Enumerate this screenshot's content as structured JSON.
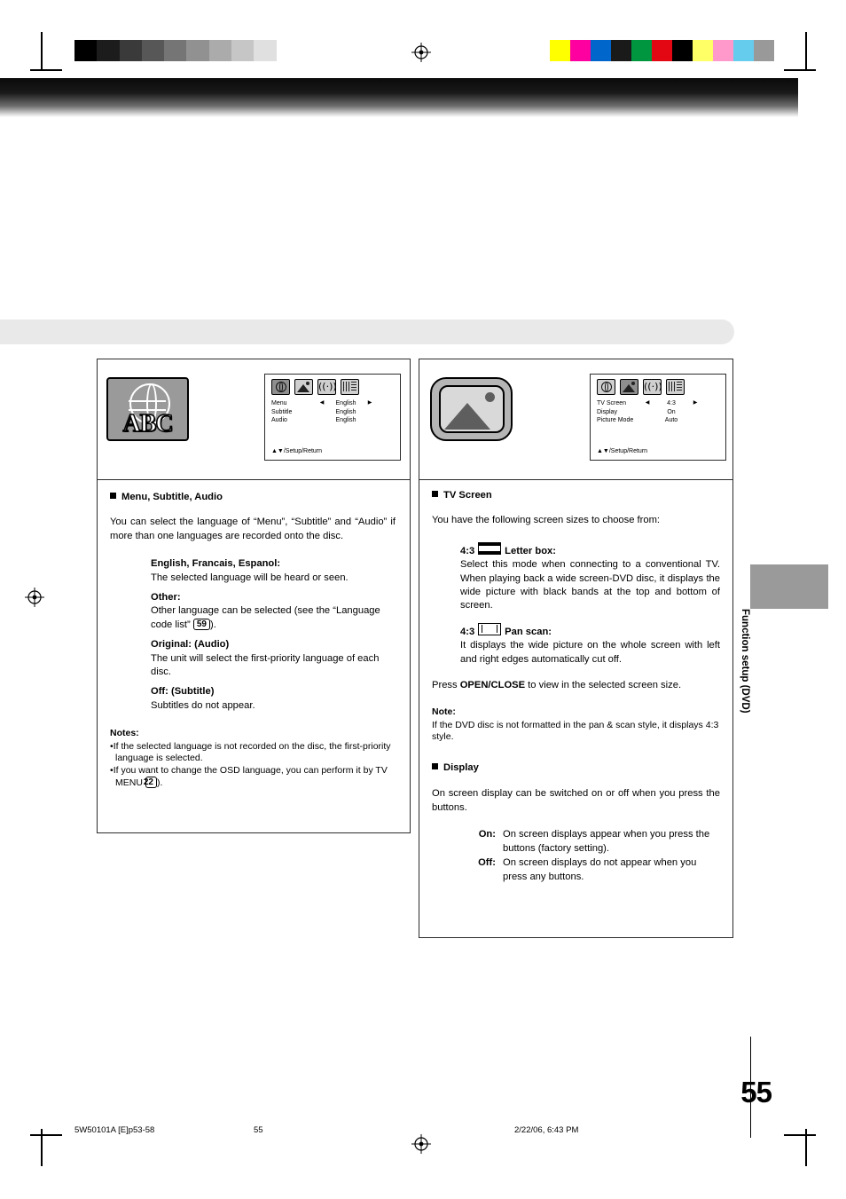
{
  "document": {
    "page_number": "55",
    "side_tab_label": "Function setup (DVD)"
  },
  "footer": {
    "left": "5W50101A [E]p53-58",
    "center": "55",
    "right": "2/22/06, 6:43 PM"
  },
  "left_panel": {
    "illustration": {
      "icon_name": "globe-abc-icon",
      "abc_text": "ABC"
    },
    "osd": {
      "icons": [
        "language-globe-icon",
        "picture-icon",
        "audio-speaker-icon",
        "equalizer-icon"
      ],
      "rows": [
        {
          "label": "Menu",
          "arrow_left": "◀",
          "value": "English",
          "arrow_right": "▶"
        },
        {
          "label": "Subtitle",
          "arrow_left": "",
          "value": "English",
          "arrow_right": ""
        },
        {
          "label": "Audio",
          "arrow_left": "",
          "value": "English",
          "arrow_right": ""
        }
      ],
      "footer": "▲▼/Setup/Return"
    },
    "heading": "Menu, Subtitle, Audio",
    "intro": "You can select the language of “Menu”, “Subtitle” and “Audio” if more than one languages are recorded onto the disc.",
    "items": [
      {
        "term": "English, Francais, Espanol:",
        "desc": "The selected language will be heard or seen."
      },
      {
        "term": "Other:",
        "desc_before": "Other language can be selected (see the “Language code list” ",
        "code": "59",
        "desc_after": ")."
      },
      {
        "term": "Original: (Audio)",
        "desc": "The unit will select the first-priority language of each disc."
      },
      {
        "term": "Off: (Subtitle)",
        "desc": "Subtitles do not appear."
      }
    ],
    "notes_title": "Notes:",
    "notes": [
      {
        "text": "If the selected language is not recorded on the disc, the first-priority language is selected."
      },
      {
        "text_before": "If you want to change the OSD language, you can perform it by TV MENU ",
        "code": "22",
        "text_after": ")."
      }
    ]
  },
  "right_panel": {
    "illustration": {
      "icon_name": "tv-screen-icon"
    },
    "osd": {
      "icons": [
        "language-globe-icon",
        "picture-icon",
        "audio-speaker-icon",
        "equalizer-icon"
      ],
      "rows": [
        {
          "label": "TV Screen",
          "arrow_left": "◀",
          "value": "4:3",
          "arrow_right": "▶"
        },
        {
          "label": "Display",
          "arrow_left": "",
          "value": "On",
          "arrow_right": ""
        },
        {
          "label": "Picture Mode",
          "arrow_left": "",
          "value": "Auto",
          "arrow_right": ""
        }
      ],
      "footer": "▲▼/Setup/Return"
    },
    "heading_tv": "TV Screen",
    "intro_tv": "You have the following screen sizes to choose from:",
    "modes": [
      {
        "ratio": "4:3",
        "glyph": "letterbox-glyph",
        "term": "Letter box:",
        "desc": "Select this mode when connecting to a conventional TV. When playing back a wide screen-DVD disc, it displays the wide picture with black bands at the top and bottom of screen."
      },
      {
        "ratio": "4:3",
        "glyph": "panscan-glyph",
        "term": "Pan scan:",
        "desc": "It displays the wide picture on the whole screen with left and right edges automatically cut off."
      }
    ],
    "press_before": "Press ",
    "press_bold": "OPEN/CLOSE",
    "press_after": " to view in the selected screen size.",
    "note_title": "Note:",
    "note_text": "If the DVD disc is not formatted in the pan & scan style, it displays 4:3 style.",
    "heading_display": "Display",
    "display_intro": "On screen display can be switched on or off when you press the buttons.",
    "display_options": [
      {
        "term": "On:",
        "desc": "On screen displays appear when you press the buttons (factory setting)."
      },
      {
        "term": "Off:",
        "desc": "On screen displays do not appear when you press any buttons."
      }
    ]
  },
  "color_bars": {
    "left": [
      "#000000",
      "#1c1c1c",
      "#3a3a3a",
      "#575757",
      "#757575",
      "#919191",
      "#ababab",
      "#c6c6c6",
      "#e0e0e0",
      "#ffffff"
    ],
    "right": [
      "#ffff00",
      "#ff00a0",
      "#0066cc",
      "#1a1a1a",
      "#009640",
      "#e30613",
      "#000000",
      "#ffff66",
      "#ff99cc",
      "#66ccee",
      "#999999"
    ]
  }
}
